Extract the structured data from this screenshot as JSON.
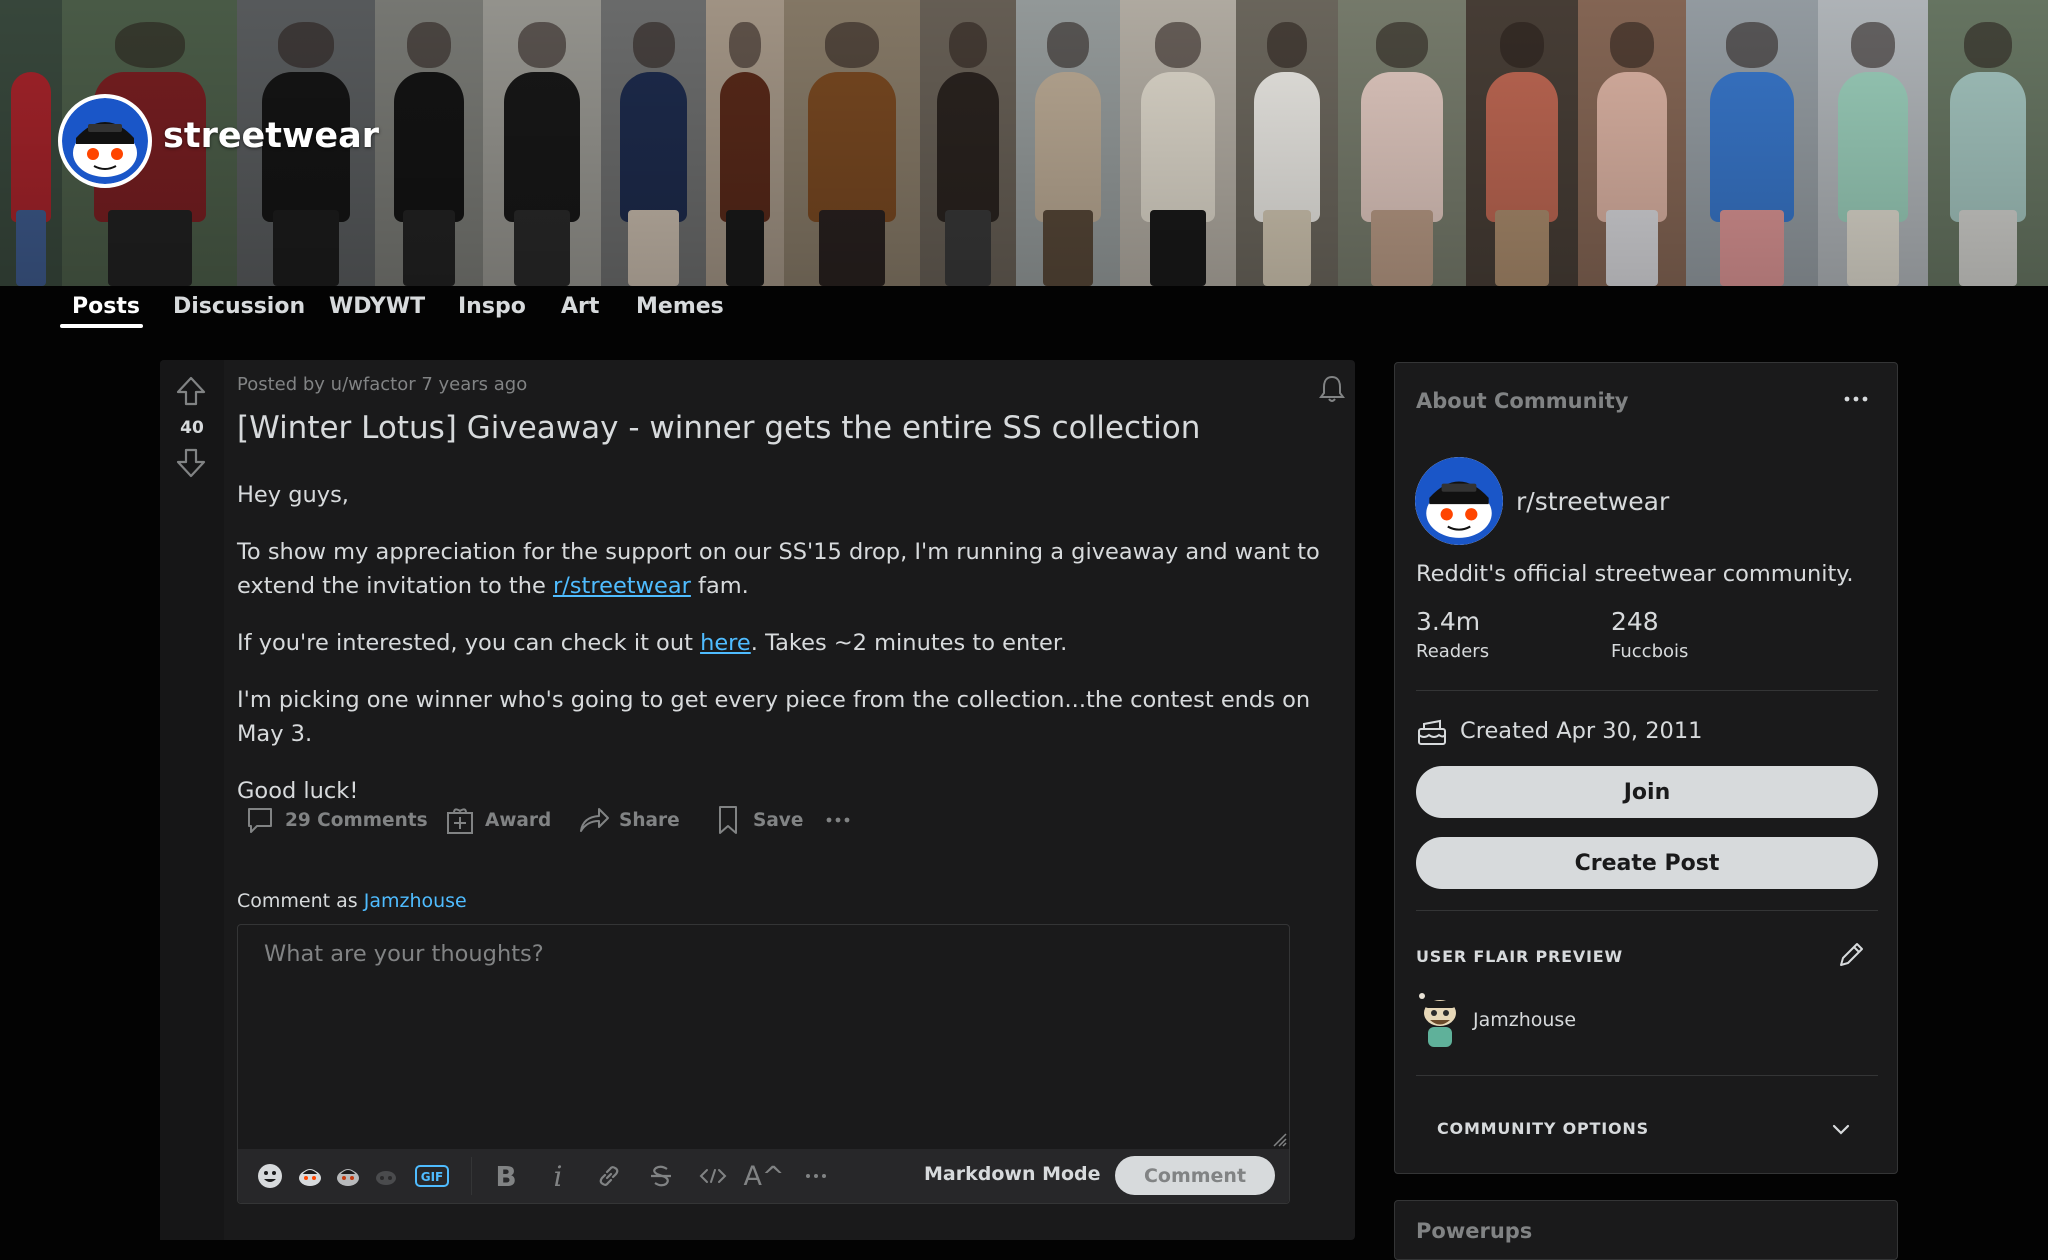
{
  "subreddit": {
    "name": "streetwear",
    "nav_tabs": [
      {
        "label": "Posts",
        "active": true
      },
      {
        "label": "Discussion"
      },
      {
        "label": "WDYWT"
      },
      {
        "label": "Inspo"
      },
      {
        "label": "Art"
      },
      {
        "label": "Memes"
      }
    ]
  },
  "post": {
    "meta": "Posted by u/wfactor 7 years ago",
    "score": "40",
    "title": "[Winter Lotus] Giveaway - winner gets the entire SS collection",
    "body": {
      "p1": "Hey guys,",
      "p2_before": "To show my appreciation for the support on our SS'15 drop, I'm running a giveaway and want to extend the invitation to the ",
      "p2_link": "r/streetwear",
      "p2_after": " fam.",
      "p3_before": "If you're interested, you can check it out ",
      "p3_link": "here",
      "p3_after": ". Takes ~2 minutes to enter.",
      "p4": "I'm picking one winner who's going to get every piece from the collection...the contest ends on May 3.",
      "p5": "Good luck!"
    },
    "actions": {
      "comments": "29 Comments",
      "award": "Award",
      "share": "Share",
      "save": "Save"
    }
  },
  "comment_box": {
    "prefix": "Comment as",
    "username": "Jamzhouse",
    "placeholder": "What are your thoughts?",
    "markdown_mode": "Markdown Mode",
    "submit": "Comment",
    "toolbar_icons": [
      "emoji-icon",
      "snoo-icon",
      "snoo-icon",
      "snoo-icon",
      "gif-icon",
      "bold-icon",
      "italic-icon",
      "link-icon",
      "strikethrough-icon",
      "inline-code-icon",
      "superscript-icon",
      "more-icon"
    ],
    "gif_label": "GIF",
    "bold_glyph": "B",
    "italic_glyph": "i",
    "superscript_glyph": "A^"
  },
  "sidebar": {
    "about_title": "About Community",
    "community": "r/streetwear",
    "description": "Reddit's official streetwear community.",
    "stats": [
      {
        "value": "3.4m",
        "label": "Readers"
      },
      {
        "value": "248",
        "label": "Fuccbois"
      }
    ],
    "created": "Created Apr 30, 2011",
    "join": "Join",
    "create_post": "Create Post",
    "flair_title": "USER FLAIR PREVIEW",
    "flair_user": "Jamzhouse",
    "options_title": "COMMUNITY OPTIONS",
    "powerups_title": "Powerups"
  },
  "colors": {
    "background": "#030303",
    "card": "#1a1a1b",
    "text": "#d7dadc",
    "muted": "#818384",
    "link": "#4fbcff",
    "button": "#d7dadc"
  }
}
